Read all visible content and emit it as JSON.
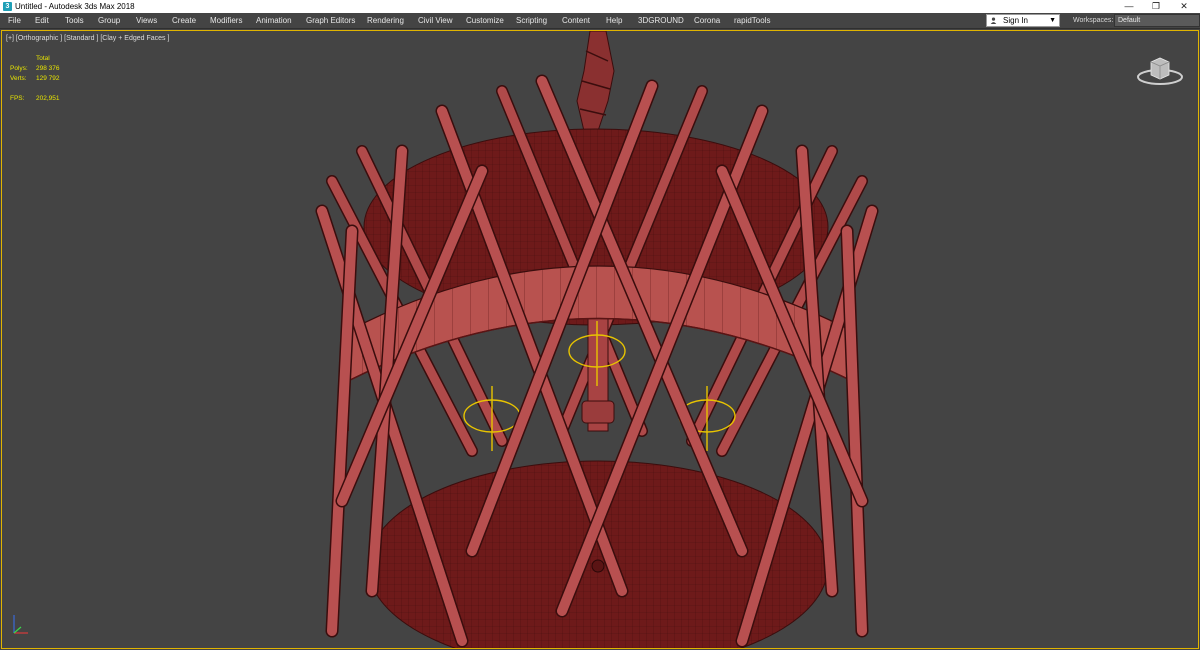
{
  "window": {
    "title": "Untitled - Autodesk 3ds Max 2018",
    "app_icon": "3",
    "minimize_glyph": "—",
    "restore_glyph": "❐",
    "close_glyph": "✕"
  },
  "menu": {
    "items": [
      "File",
      "Edit",
      "Tools",
      "Group",
      "Views",
      "Create",
      "Modifiers",
      "Animation",
      "Graph Editors",
      "Rendering",
      "Civil View",
      "Customize",
      "Scripting",
      "Content",
      "Help",
      "3DGROUND",
      "Corona",
      "rapidTools"
    ]
  },
  "account": {
    "sign_in": "Sign In",
    "caret": "▼"
  },
  "workspaces": {
    "label": "Workspaces:",
    "value": "Default"
  },
  "viewport": {
    "label": "[+] [Orthographic ] [Standard ] [Clay + Edged Faces ]",
    "stats": {
      "header": "Total",
      "polys_label": "Polys:",
      "polys_value": "298 376",
      "verts_label": "Verts:",
      "verts_value": "129 792",
      "fps_label": "FPS:",
      "fps_value": "202,951"
    }
  },
  "colors": {
    "viewport_bg": "#444444",
    "active_border": "#e0b400",
    "stats_text": "#e9e600",
    "model_fill": "#b04a4a",
    "model_dark": "#6e1a1a",
    "wire": "#3a0d0d",
    "light_helper": "#e8c400"
  },
  "icons": [
    "app-icon",
    "user-icon",
    "minimize-icon",
    "restore-icon",
    "close-icon",
    "viewcube-icon",
    "axis-tripod-icon"
  ]
}
